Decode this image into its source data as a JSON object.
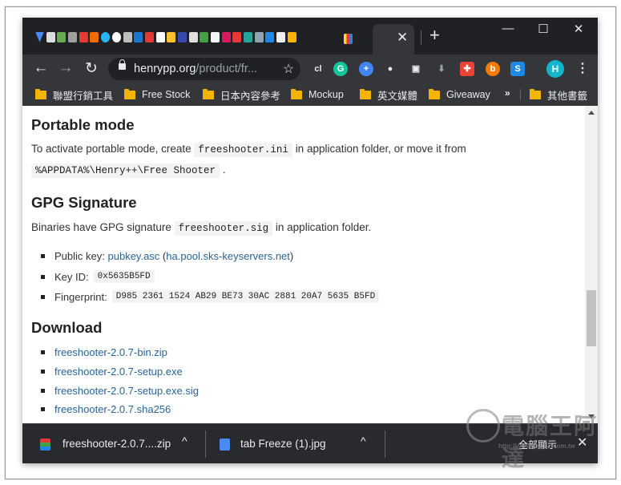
{
  "browser": {
    "url_domain": "henrypp.org",
    "url_path": "/product/fr...",
    "tab_close_glyph": "✕",
    "new_tab_glyph": "+",
    "window": {
      "minimize": "—",
      "maximize": "☐",
      "close": "✕"
    },
    "nav": {
      "back": "←",
      "forward": "→",
      "reload": "↻"
    },
    "star_glyph": "☆",
    "avatar": "H",
    "menu_glyph": "⋮",
    "extensions": [
      {
        "name": "cl-extension",
        "label": "cl",
        "color": "#35363a",
        "text": "#e8eaed"
      },
      {
        "name": "grammarly-icon",
        "label": "G",
        "color": "#15c39a"
      },
      {
        "name": "add-icon",
        "label": "+",
        "color": "#4285f4"
      },
      {
        "name": "chat-icon",
        "label": "●",
        "color": "#35363a",
        "text": "#e8eaed"
      },
      {
        "name": "image-icon",
        "label": "▣",
        "color": "#35363a",
        "text": "#e8eaed"
      },
      {
        "name": "download-icon",
        "label": "⬇",
        "color": "#35363a",
        "text": "#9aa0a6"
      },
      {
        "name": "puzzle-icon",
        "label": "✚",
        "color": "#ea4335"
      },
      {
        "name": "b-icon",
        "label": "b",
        "color": "#f57c00"
      },
      {
        "name": "s-icon",
        "label": "S",
        "color": "#1e88e5"
      }
    ]
  },
  "bookmarks": {
    "items": [
      "聯盟行銷工具",
      "Free Stock",
      "日本內容參考",
      "Mockup",
      "英文媒體",
      "Giveaway"
    ],
    "more": "»",
    "other": "其他書籤"
  },
  "page": {
    "portable": {
      "heading": "Portable mode",
      "text_before": "To activate portable mode, create",
      "code1": "freeshooter.ini",
      "text_after": "in application folder, or move it from",
      "code2": "%APPDATA%\\Henry++\\Free Shooter",
      "tail": "."
    },
    "gpg": {
      "heading": "GPG Signature",
      "text_before": "Binaries have GPG signature",
      "code": "freeshooter.sig",
      "text_after": "in application folder.",
      "public_key_label": "Public key:",
      "public_key_link": "pubkey.asc",
      "keyserver_open": "(",
      "keyserver_link": "ha.pool.sks-keyservers.net",
      "keyserver_close": ")",
      "key_id_label": "Key ID:",
      "key_id": "0x5635B5FD",
      "fingerprint_label": "Fingerprint:",
      "fingerprint": "D985 2361 1524 AB29 BE73 30AC 2881 20A7 5635 B5FD"
    },
    "download": {
      "heading": "Download",
      "links": [
        "freeshooter-2.0.7-bin.zip",
        "freeshooter-2.0.7-setup.exe",
        "freeshooter-2.0.7-setup.exe.sig",
        "freeshooter-2.0.7.sha256"
      ]
    }
  },
  "downloads": {
    "items": [
      {
        "name": "freeshooter-2.0.7....zip",
        "caret": "^"
      },
      {
        "name": "tab Freeze (1).jpg",
        "caret": "^"
      }
    ],
    "show_all": "全部顯示",
    "close": "✕"
  },
  "watermark": {
    "text": "電腦王阿達",
    "url": "http://www.kocpc.com.tw"
  },
  "colors": {
    "tab_strip": "#202124",
    "toolbar": "#35363a",
    "link": "#2a6496",
    "folder": "#f4b400"
  }
}
